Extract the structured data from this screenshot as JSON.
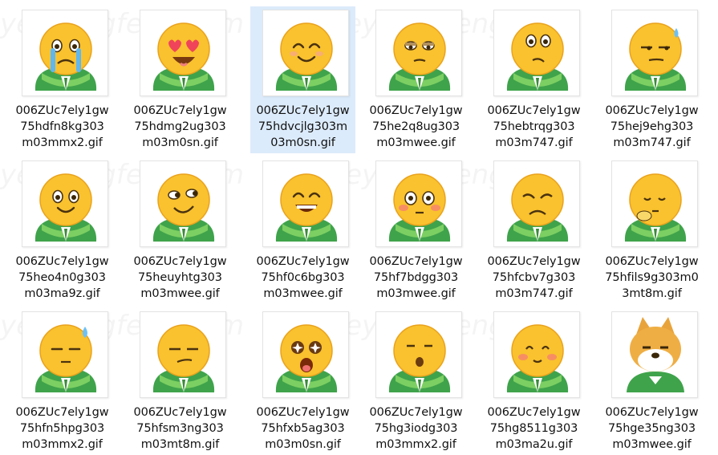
{
  "watermark": "yeyulingfeng.com",
  "files": [
    {
      "line1": "006ZUc7ely1gw",
      "line2": "75hdfn8kg303",
      "line3": "m03mmx2.gif",
      "icon": "crying-emoji-icon",
      "face": "cry"
    },
    {
      "line1": "006ZUc7ely1gw",
      "line2": "75hdmg2ug303",
      "line3": "m03m0sn.gif",
      "icon": "heart-eyes-emoji-icon",
      "face": "heart"
    },
    {
      "line1": "006ZUc7ely1gw",
      "line2": "75hdvcjlg303m",
      "line3": "03m0sn.gif",
      "icon": "smiling-emoji-icon",
      "face": "smile",
      "selected": true
    },
    {
      "line1": "006ZUc7ely1gw",
      "line2": "75he2q8ug303",
      "line3": "m03mwee.gif",
      "icon": "unamused-emoji-icon",
      "face": "meh"
    },
    {
      "line1": "006ZUc7ely1gw",
      "line2": "75hebtrqg303",
      "line3": "m03m747.gif",
      "icon": "thinking-emoji-icon",
      "face": "think"
    },
    {
      "line1": "006ZUc7ely1gw",
      "line2": "75hej9ehg303",
      "line3": "m03m747.gif",
      "icon": "sweat-side-eye-emoji-icon",
      "face": "sweatside"
    },
    {
      "line1": "006ZUc7ely1gw",
      "line2": "75heo4n0g303",
      "line3": "m03ma9z.gif",
      "icon": "grinning-emoji-icon",
      "face": "grin"
    },
    {
      "line1": "006ZUc7ely1gw",
      "line2": "75heuyhtg303",
      "line3": "m03mwee.gif",
      "icon": "smirk-eyes-emoji-icon",
      "face": "smirk"
    },
    {
      "line1": "006ZUc7ely1gw",
      "line2": "75hf0c6bg303",
      "line3": "m03mwee.gif",
      "icon": "big-smile-emoji-icon",
      "face": "bigsmile"
    },
    {
      "line1": "006ZUc7ely1gw",
      "line2": "75hf7bdgg303",
      "line3": "m03mwee.gif",
      "icon": "flushed-emoji-icon",
      "face": "flushed"
    },
    {
      "line1": "006ZUc7ely1gw",
      "line2": "75hfcbv7g303",
      "line3": "m03m747.gif",
      "icon": "worried-emoji-icon",
      "face": "worried"
    },
    {
      "line1": "006ZUc7ely1gw",
      "line2": "75hfils9g303m0",
      "line3": "3mt8m.gif",
      "icon": "pondering-emoji-icon",
      "face": "ponder"
    },
    {
      "line1": "006ZUc7ely1gw",
      "line2": "75hfn5hpg303",
      "line3": "m03mmx2.gif",
      "icon": "speechless-sweat-emoji-icon",
      "face": "speechless"
    },
    {
      "line1": "006ZUc7ely1gw",
      "line2": "75hfsm3ng303",
      "line3": "m03mt8m.gif",
      "icon": "smug-emoji-icon",
      "face": "smug"
    },
    {
      "line1": "006ZUc7ely1gw",
      "line2": "75hfxb5ag303",
      "line3": "m03m0sn.gif",
      "icon": "star-eyes-emoji-icon",
      "face": "stars"
    },
    {
      "line1": "006ZUc7ely1gw",
      "line2": "75hg3iodg303",
      "line3": "m03mmx2.gif",
      "icon": "whistling-emoji-icon",
      "face": "whistle"
    },
    {
      "line1": "006ZUc7ely1gw",
      "line2": "75hg8511g303",
      "line3": "m03ma2u.gif",
      "icon": "shy-emoji-icon",
      "face": "shy"
    },
    {
      "line1": "006ZUc7ely1gw",
      "line2": "75hge35ng303",
      "line3": "m03mwee.gif",
      "icon": "doge-emoji-icon",
      "face": "doge"
    }
  ]
}
